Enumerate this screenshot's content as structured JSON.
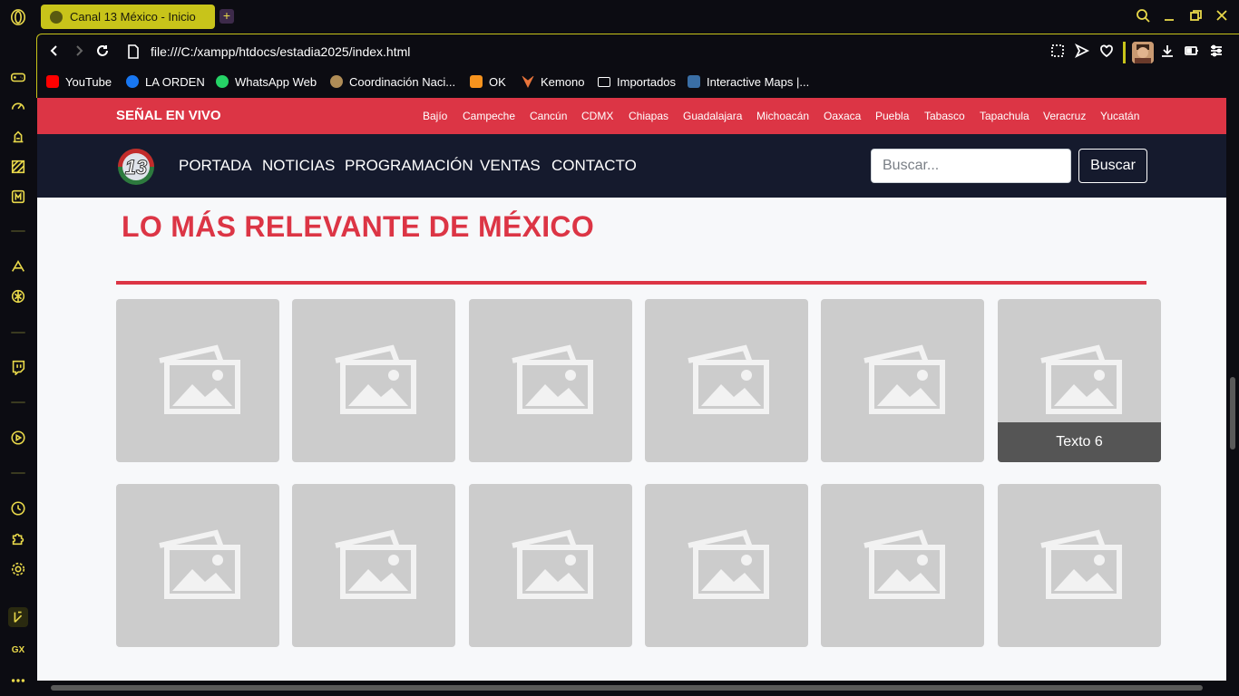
{
  "browser": {
    "tab_title": "Canal 13 México - Inicio",
    "new_tab": "+",
    "url": "file:///C:/xampp/htdocs/estadia2025/index.html",
    "sidebar_label": "GX",
    "accent_color": "#e8d84a"
  },
  "bookmarks": [
    {
      "label": "YouTube",
      "color": "#ff0000"
    },
    {
      "label": "LA ORDEN",
      "color": "#1877f2"
    },
    {
      "label": "WhatsApp Web",
      "color": "#25d366"
    },
    {
      "label": "Coordinación Naci...",
      "color": "#b08d57"
    },
    {
      "label": "OK",
      "color": "#f7931e"
    },
    {
      "label": "Kemono",
      "color": "#e8743b"
    },
    {
      "label": "Importados",
      "color": "#0c0c12"
    },
    {
      "label": "Interactive Maps |...",
      "color": "#3a6ea5"
    }
  ],
  "site": {
    "live_label": "SEÑAL EN VIVO",
    "cities": [
      "Bajío",
      "Campeche",
      "Cancún",
      "CDMX",
      "Chiapas",
      "Guadalajara",
      "Michoacán",
      "Oaxaca",
      "Puebla",
      "Tabasco",
      "Tapachula",
      "Veracruz",
      "Yucatán"
    ],
    "logo_text": "13",
    "nav": [
      "PORTADA",
      "NOTICIAS",
      "PROGRAMACIÓN",
      "VENTAS",
      "CONTACTO"
    ],
    "search_placeholder": "Buscar...",
    "search_button": "Buscar",
    "section_title": "LO MÁS RELEVANTE DE MÉXICO",
    "brand_red": "#dc3545",
    "nav_bg": "#151a2d"
  },
  "cards": [
    {
      "caption": ""
    },
    {
      "caption": ""
    },
    {
      "caption": ""
    },
    {
      "caption": ""
    },
    {
      "caption": ""
    },
    {
      "caption": "Texto 6"
    },
    {
      "caption": ""
    },
    {
      "caption": ""
    },
    {
      "caption": ""
    },
    {
      "caption": ""
    },
    {
      "caption": ""
    },
    {
      "caption": ""
    }
  ]
}
